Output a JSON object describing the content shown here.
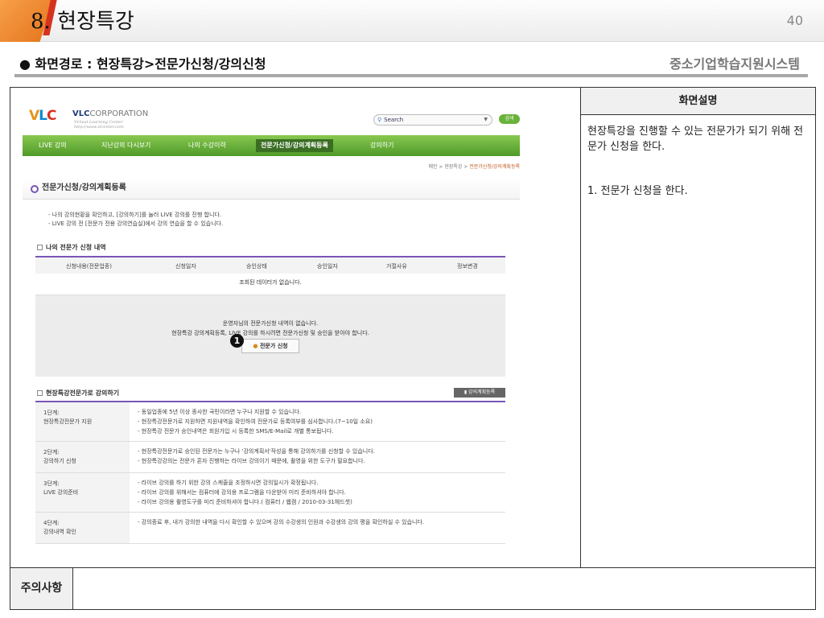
{
  "slide": {
    "section_number": "8.",
    "section_title": "현장특강",
    "page_number": "40",
    "path": "● 화면경로 : 현장특강>전문가신청/강의신청",
    "system_name": "중소기업학습지원시스템",
    "panel_title": "화면설명",
    "panel_desc": "현장특강을 진행할 수 있는 전문가가 되기 위해 전문가 신청을 한다.",
    "panel_step": "1. 전문가 신청을 한다.",
    "notice_label": "주의사항"
  },
  "site": {
    "logo_v": "V",
    "logo_l": "L",
    "logo_c": "C",
    "corp_name": "VLC",
    "corp_suffix": "CORPORATION",
    "corp_sub1": "Virtual Learning Center",
    "corp_sub2": "http://www.vlcenter.com",
    "search_placeholder": "Search",
    "search_button": "검색",
    "nav": [
      "LIVE 강의",
      "지난강의 다시보기",
      "나의 수강이력",
      "전문가신청/강의계획등록",
      "강의하기"
    ],
    "breadcrumb_prefix": "메인 > 현장특강 > ",
    "breadcrumb_current": "전문가신청/강의계획등록",
    "page_title": "전문가신청/강의계획등록",
    "intro1": "- 나의 강의현황을 확인하고, [강의하기]를 눌러 LIVE 강의를 진행 합니다.",
    "intro2": "- LIVE 강의 전 [전문가 전용 강의연습실]에서 강의 연습을 할 수 있습니다.",
    "section1": "나의 전문가 신청 내역",
    "columns": [
      "신청내용(전문업종)",
      "신청일자",
      "승인상태",
      "승인일자",
      "거절사유",
      "정보변경"
    ],
    "no_data": "조회된 데이터가 없습니다.",
    "gb_line1": "운영자님의 전문가신청 내역이 없습니다.",
    "gb_line2": "현장특강 강의계획등록, LIVE 강의를 하시려면 전문가신청 및 승인을 받아야 합니다.",
    "apply_button": "전문가 신청",
    "marker": "1",
    "section2": "현장특강전문가로 강의하기",
    "plan_button": "강의계획등록",
    "steps": [
      {
        "label1": "1단계:",
        "label2": "현장특강전문가 지원",
        "lines": [
          "- 동일업종에 5년 이상 종사한 국민이라면 누구나 지원할 수 있습니다.",
          "- 현장특강전문가로 지원하면 지원내역을 확인하여 전문가로 등록여부를 심사합니다.(7~10일 소요)",
          "- 현장특강 전문가 승인내역은 회원가입 시 등록한 SMS/E-Mail로 개별 통보됩니다."
        ]
      },
      {
        "label1": "2단계:",
        "label2": "강의하기 신청",
        "lines": [
          "- 현장특강전문가로 승인된 전문가는 누구나 '강의계획서'작성을 통해 강의하기를 신청할 수 있습니다.",
          "- 현장특강강의는 전문가 혼자 진행하는 라이브 강의이기 때문에, 촬영을 위한 도구가 필요합니다."
        ]
      },
      {
        "label1": "3단계:",
        "label2": "LIVE 강의준비",
        "lines": [
          "- 라이브 강의를 하기 위한 강의 스케줄을 조정하시면 강의일시가 확정됩니다.",
          "- 라이브 강의를 위해서는 컴퓨터에 강의용 프로그램을 다운받아 미리 준비하셔야 합니다.",
          "- 라이브 강의용 촬영도구를 미리 준비하셔야 합니다.( 컴퓨터 / 웹캠 / 2010-03-31헤드셋)"
        ]
      },
      {
        "label1": "4단계:",
        "label2": "강의내역 확인",
        "lines": [
          "- 강의종료 후, 내가 강의한 내역을 다시 확인할 수 있으며 강의 수강생의 인원과 수강생의 강의 평을 확인하실 수 있습니다."
        ]
      }
    ]
  }
}
